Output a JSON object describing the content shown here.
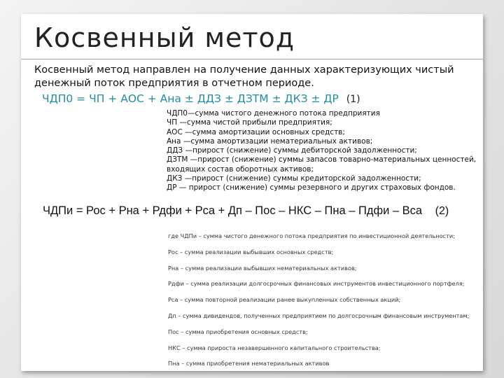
{
  "title": "Косвенный метод",
  "intro": "Косвенный метод направлен на получение данных характеризующих чистый денежный поток предприятия в отчетном периоде.",
  "formula1": {
    "expression": "ЧДП0 = ЧП + АОС + Ана ± ДДЗ ± ДЗТМ ± ДКЗ ± ДР",
    "number": "(1)"
  },
  "legend1": [
    "ЧДП0—сумма чистого денежного потока предприятия",
    "ЧП —сумма чистой прибыли предприятия;",
    "АОС —сумма амортизации основных средств;",
    "Ана —сумма амортизации нематериальных активов;",
    "ДДЗ —прирост (снижение) суммы дебиторской задолженности;",
    "ДЗТМ —прирост (снижение) суммы запасов товарно-материальных ценностей, входящих состав оборотных активов;",
    "ДКЗ —прирост (снижение) суммы кредиторской задолженности;",
    "ДР — прирост (снижение) суммы резервного и других страховых фондов."
  ],
  "formula2": {
    "expression": "ЧДПи = Рос + Рна + Рдфи + Рса + Дп – Пос – НКС – Пна – Пдфи – Вса",
    "number": "(2)"
  },
  "legend2": [
    "где ЧДПи – сумма чистого денежного потока предприятия по инвестиционной деятельности;",
    "Рос – сумма реализации выбывших основных средств;",
    "Рна – сумма реализации выбывших нематериальных активов;",
    "Рдфи – сумма реализации долгосрочных финансовых инструментов инвестиционного портфеля;",
    "Рса – сумма повторной реализации ранее выкупленных собственных акций;",
    "Дп – сумма дивидендов, полученных предприятием по долгосрочным финансовым инструментам;",
    "Пос – сумма приобретения основных средств;",
    "НКС – сумма прироста незавершенного капитального строительства;",
    "Пна – сумма приобретения нематериальных активов"
  ],
  "colors": {
    "formula1": "#1f8ca3",
    "divider": "#9aa6b2",
    "background": "#ffffff"
  }
}
